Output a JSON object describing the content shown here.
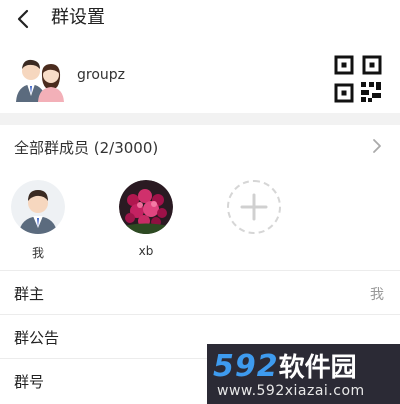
{
  "header": {
    "title": "群设置"
  },
  "group": {
    "name": "groupz"
  },
  "members": {
    "title": "全部群成员 (2/3000)",
    "list": [
      {
        "name": "我"
      },
      {
        "name": "xb"
      }
    ]
  },
  "rows": [
    {
      "label": "群主",
      "value": "我"
    },
    {
      "label": "群公告",
      "value": ""
    },
    {
      "label": "群号",
      "value": ""
    }
  ],
  "watermark": {
    "brand": "592",
    "brand_cn": "软件园",
    "url": "www.592xiazai.com"
  },
  "colors": {
    "accent": "#3e9bef",
    "divider": "#ececec",
    "section_gap": "#f2f2f2"
  }
}
